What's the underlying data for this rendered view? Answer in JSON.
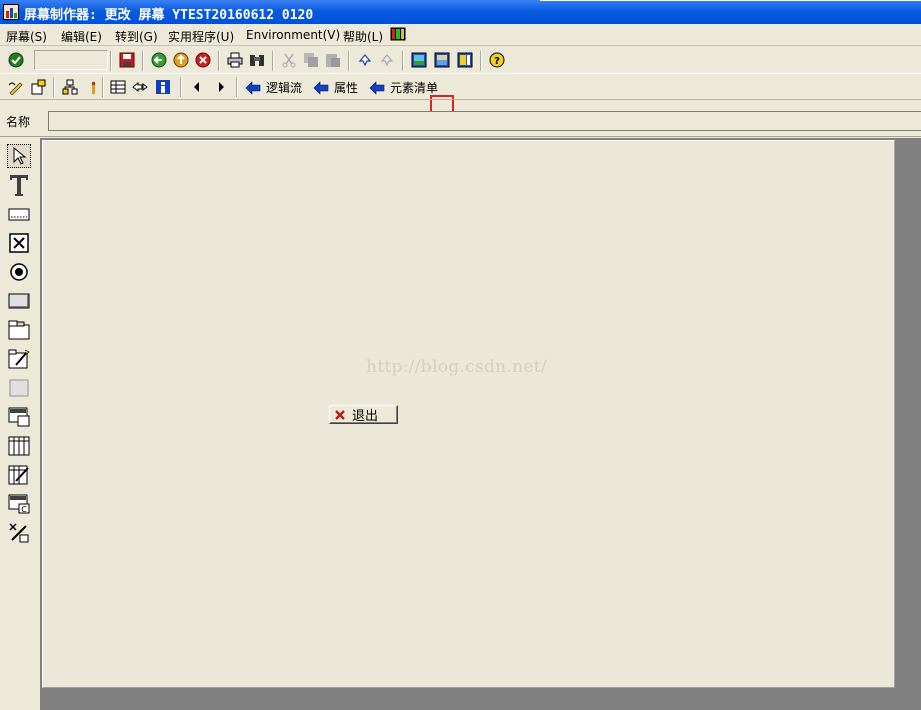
{
  "window": {
    "title": "屏幕制作器:  更改 屏幕 YTEST20160612 0120"
  },
  "menubar": {
    "items": [
      {
        "label": "屏幕(S)"
      },
      {
        "label": "编辑(E)"
      },
      {
        "label": "转到(G)"
      },
      {
        "label": "实用程序(U)"
      },
      {
        "label": "Environment(V)"
      },
      {
        "label": "帮助(L)"
      }
    ]
  },
  "toolbar2": {
    "nav_buttons": [
      {
        "label": "逻辑流"
      },
      {
        "label": "属性"
      },
      {
        "label": "元素清单"
      }
    ]
  },
  "namebar": {
    "label": "名称",
    "value": ""
  },
  "canvas": {
    "watermark": "http://blog.csdn.net/",
    "exit_button_label": "退出"
  },
  "colors": {
    "title_bar": "#0a5ce0",
    "window_bg": "#ece9d8",
    "canvas_bg": "#ece8d8",
    "canvas_frame": "#808080",
    "highlight_border": "#e02020",
    "nav_arrow": "#1040c0"
  },
  "icons": {
    "toolbar1": [
      "check-icon",
      "save-icon",
      "back-icon",
      "exit-icon",
      "cancel-icon",
      "print-icon",
      "find-icon",
      "cut-icon",
      "copy-icon",
      "paste-icon",
      "undo-icon",
      "redo-icon",
      "layout-mode-1-icon",
      "layout-mode-2-icon",
      "layout-mode-3-icon",
      "help-icon"
    ],
    "toolbar2": [
      "edit-icon",
      "new-element-icon",
      "hierarchy-icon",
      "marker-icon",
      "input-format-icon",
      "field-arrows-icon",
      "info-icon",
      "prev-icon",
      "next-icon"
    ],
    "palette": [
      "pointer-icon",
      "text-field-icon",
      "input-field-icon",
      "checkbox-icon",
      "radio-button-icon",
      "push-button-icon",
      "tabstrip-icon",
      "tabstrip-wizard-icon",
      "box-icon",
      "subscreen-icon",
      "table-control-icon",
      "table-wizard-icon",
      "custom-control-icon",
      "status-icon"
    ]
  }
}
